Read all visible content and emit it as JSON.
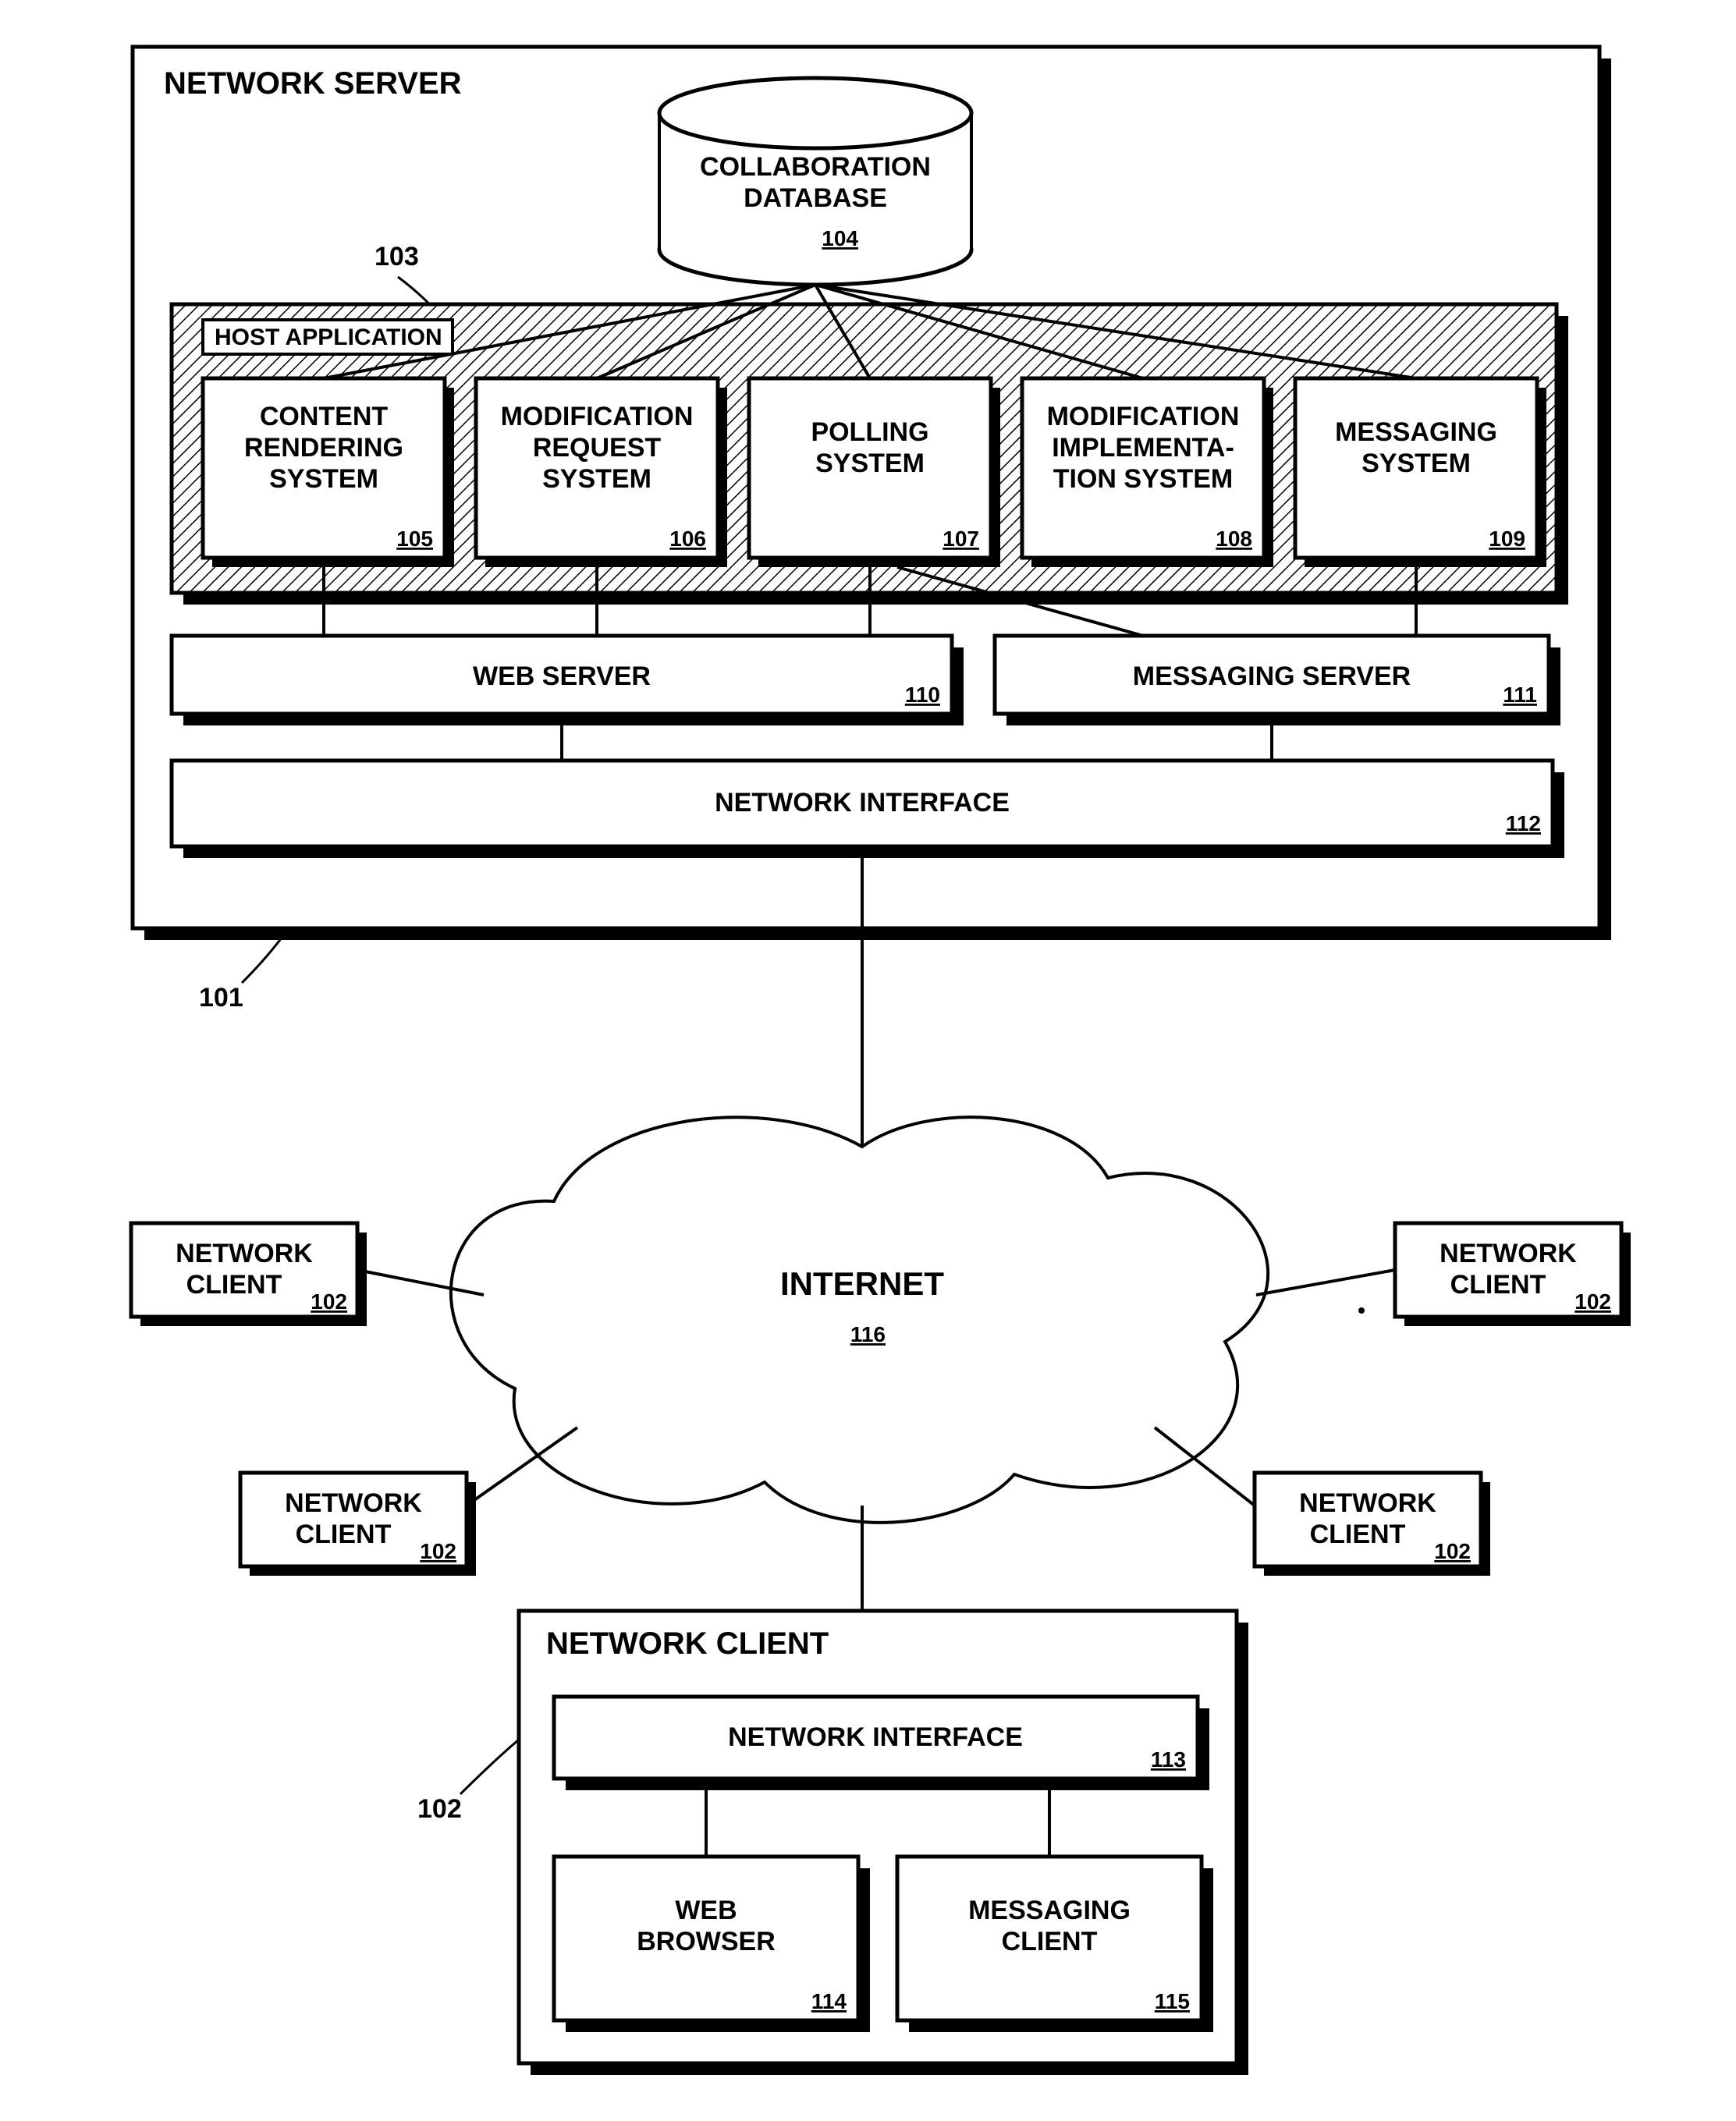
{
  "server": {
    "title": "NETWORK  SERVER",
    "id": "101",
    "db_label1": "COLLABORATION",
    "db_label2": "DATABASE",
    "db_id": "104",
    "hostapp_label": "HOST APPLICATION",
    "hostapp_id": "103",
    "modules": [
      {
        "l1": "CONTENT",
        "l2": "RENDERING",
        "l3": "SYSTEM",
        "id": "105"
      },
      {
        "l1": "MODIFICATION",
        "l2": "REQUEST",
        "l3": "SYSTEM",
        "id": "106"
      },
      {
        "l1": "POLLING",
        "l2": "SYSTEM",
        "l3": "",
        "id": "107"
      },
      {
        "l1": "MODIFICATION",
        "l2": "IMPLEMENTA-",
        "l3": "TION SYSTEM",
        "id": "108"
      },
      {
        "l1": "MESSAGING",
        "l2": "SYSTEM",
        "l3": "",
        "id": "109"
      }
    ],
    "web_server": "WEB SERVER",
    "web_server_id": "110",
    "msg_server": "MESSAGING SERVER",
    "msg_server_id": "111",
    "net_if": "NETWORK INTERFACE",
    "net_if_id": "112"
  },
  "internet": {
    "label": "INTERNET",
    "id": "116"
  },
  "client_label1": "NETWORK",
  "client_label2": "CLIENT",
  "client_id": "102",
  "client_detail": {
    "title": "NETWORK CLIENT",
    "id": "102",
    "net_if": "NETWORK INTERFACE",
    "net_if_id": "113",
    "browser_l1": "WEB",
    "browser_l2": "BROWSER",
    "browser_id": "114",
    "msg_l1": "MESSAGING",
    "msg_l2": "CLIENT",
    "msg_id": "115"
  }
}
